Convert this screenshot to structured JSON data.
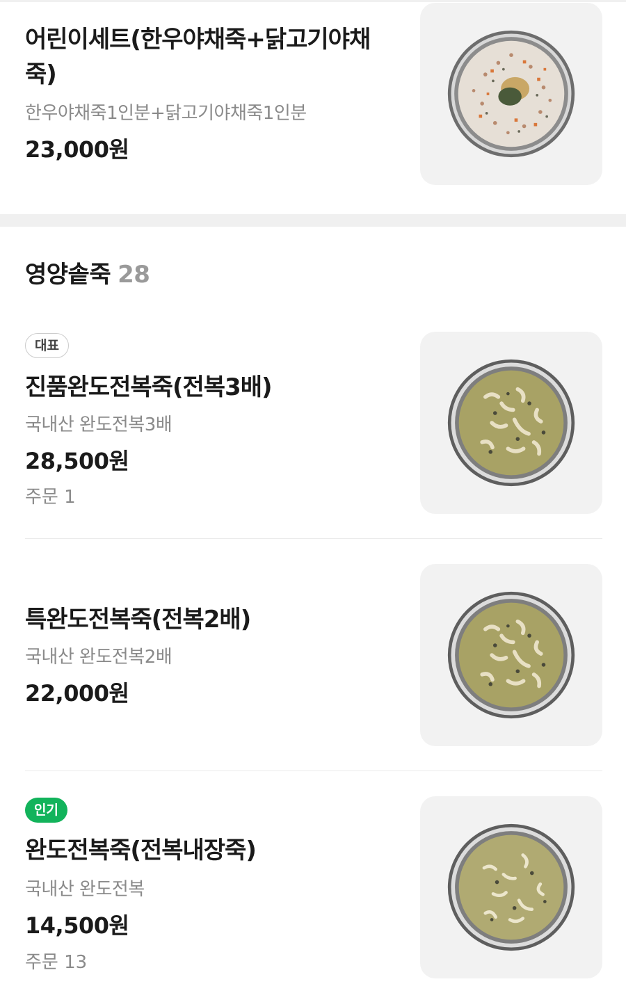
{
  "menu": {
    "set_item": {
      "title": "어린이세트(한우야채죽+닭고기야채죽)",
      "description": "한우야채죽1인분+닭고기야채죽1인분",
      "price": "23,000원",
      "image_icon": "porridge-vegetable-icon"
    },
    "section": {
      "title": "영양솥죽",
      "count": "28"
    },
    "items": [
      {
        "badge": "대표",
        "title": "진품완도전복죽(전복3배)",
        "description": "국내산 완도전복3배",
        "price": "28,500원",
        "orders": "주문 1",
        "image_icon": "abalone-porridge-icon"
      },
      {
        "title": "특완도전복죽(전복2배)",
        "description": "국내산 완도전복2배",
        "price": "22,000원",
        "image_icon": "abalone-porridge-icon"
      },
      {
        "badge": "인기",
        "title": "완도전복죽(전복내장죽)",
        "description": "국내산 완도전복",
        "price": "14,500원",
        "orders": "주문 13",
        "image_icon": "abalone-porridge-icon"
      }
    ]
  },
  "colors": {
    "badge_green": "#12b35b",
    "text_primary": "#1a1a1a",
    "text_secondary": "#8a8a8a",
    "thumb_background": "#f2f2f2"
  }
}
